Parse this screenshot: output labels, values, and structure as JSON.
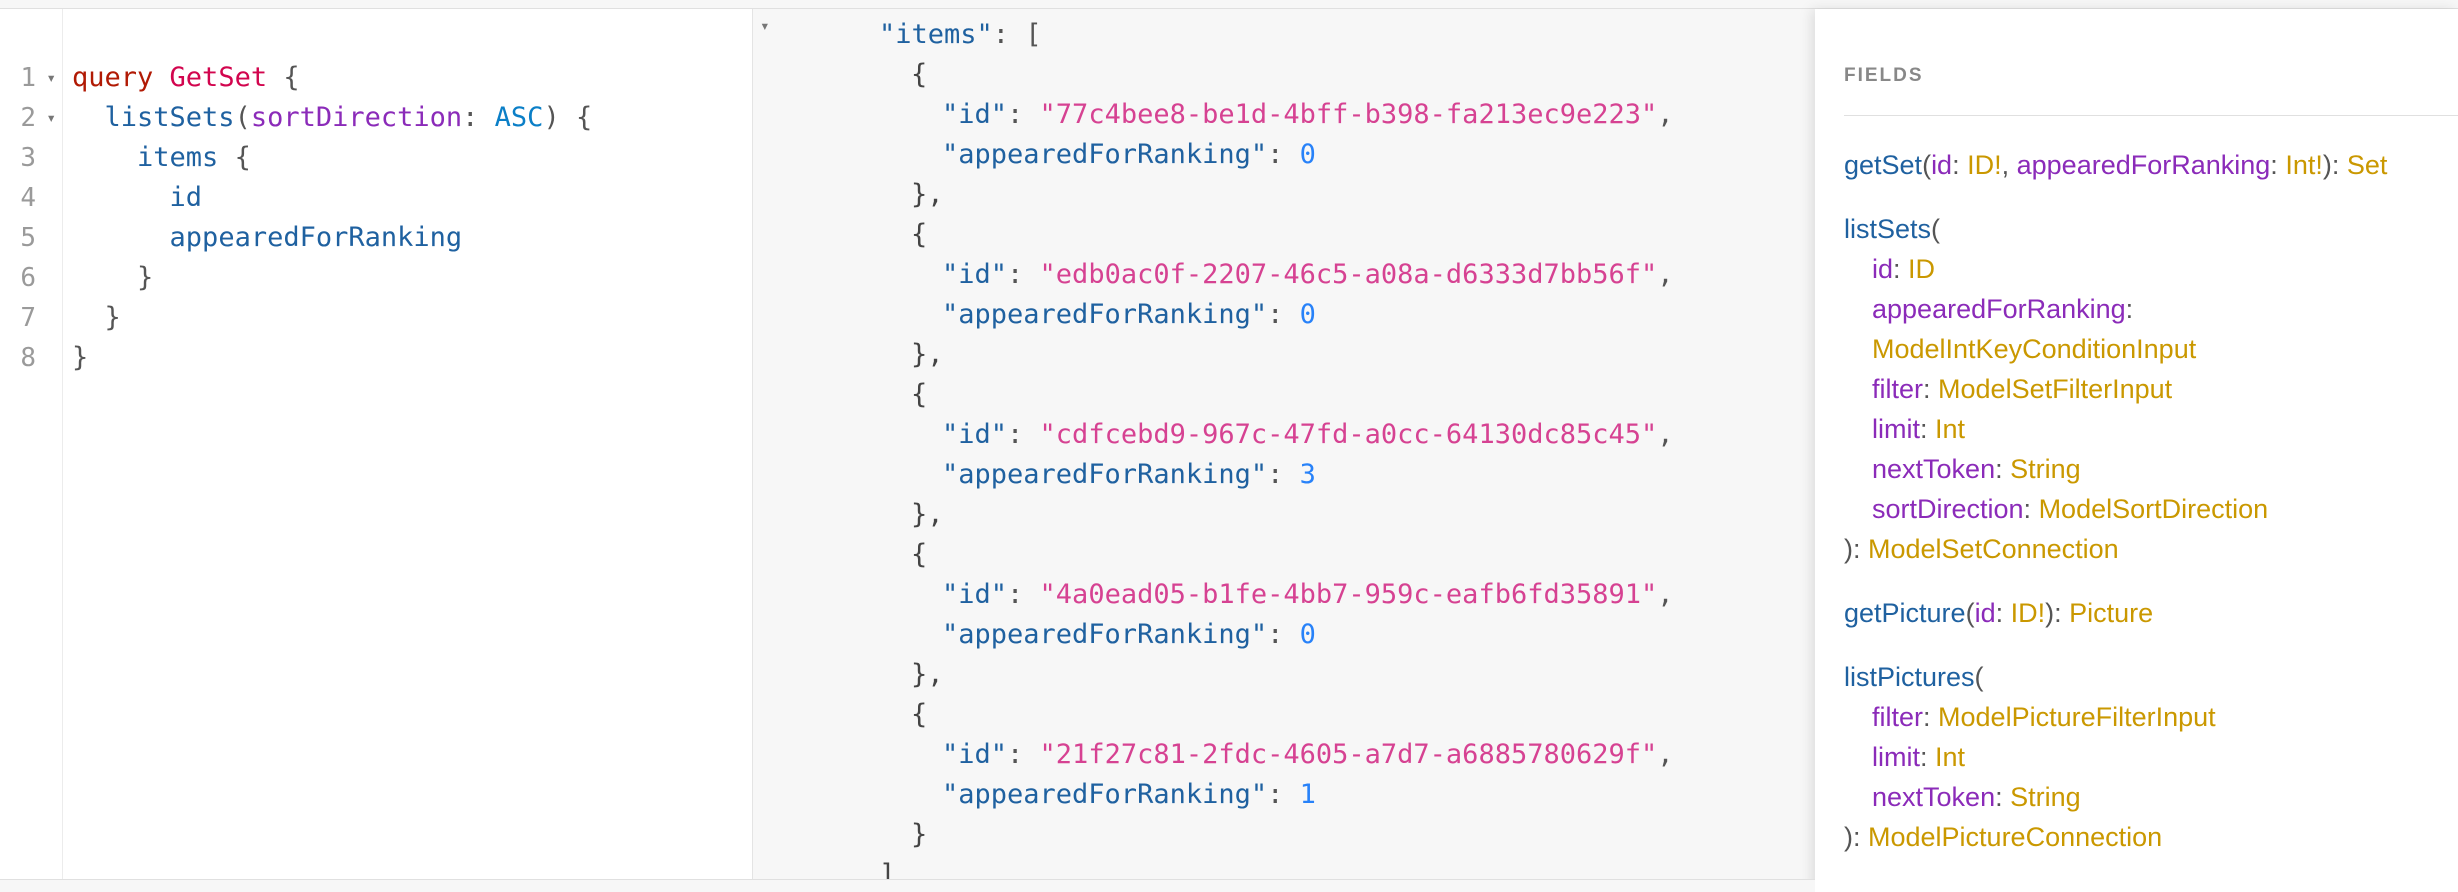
{
  "query_editor": {
    "gutter": [
      {
        "num": "1",
        "fold": "▾"
      },
      {
        "num": "2",
        "fold": "▾"
      },
      {
        "num": "3",
        "fold": ""
      },
      {
        "num": "4",
        "fold": ""
      },
      {
        "num": "5",
        "fold": ""
      },
      {
        "num": "6",
        "fold": ""
      },
      {
        "num": "7",
        "fold": ""
      },
      {
        "num": "8",
        "fold": ""
      }
    ],
    "keyword_query": "query",
    "operation_name": "GetSet",
    "open_brace": "{",
    "close_brace": "}",
    "list_sets_field": "listSets",
    "sort_arg": "sortDirection",
    "sort_value": "ASC",
    "items_field": "items",
    "id_field": "id",
    "appeared_field": "appearedForRanking"
  },
  "result_viewer": {
    "fold_marker": "▾",
    "items_key": "\"items\"",
    "open_bracket": "[",
    "close_bracket": "]",
    "id_key": "\"id\"",
    "appeared_key": "\"appearedForRanking\"",
    "records": [
      {
        "id": "\"77c4bee8-be1d-4bff-b398-fa213ec9e223\"",
        "appeared": "0"
      },
      {
        "id": "\"edb0ac0f-2207-46c5-a08a-d6333d7bb56f\"",
        "appeared": "0"
      },
      {
        "id": "\"cdfcebd9-967c-47fd-a0cc-64130dc85c45\"",
        "appeared": "3"
      },
      {
        "id": "\"4a0ead05-b1fe-4bb7-959c-eafb6fd35891\"",
        "appeared": "0"
      },
      {
        "id": "\"21f27c81-2fdc-4605-a7d7-a6885780629f\"",
        "appeared": "1"
      }
    ]
  },
  "docs": {
    "title": "FIELDS",
    "get_set": {
      "name": "getSet",
      "arg_id": "id",
      "type_id": "ID!",
      "arg_appeared": "appearedForRanking",
      "type_int_req": "Int!",
      "return_type": "Set"
    },
    "list_sets": {
      "name": "listSets",
      "args": [
        {
          "name": "id",
          "type": "ID"
        },
        {
          "name": "appearedForRanking",
          "type": "ModelIntKeyConditionInput"
        },
        {
          "name": "filter",
          "type": "ModelSetFilterInput"
        },
        {
          "name": "limit",
          "type": "Int"
        },
        {
          "name": "nextToken",
          "type": "String"
        },
        {
          "name": "sortDirection",
          "type": "ModelSortDirection"
        }
      ],
      "return_type": "ModelSetConnection"
    },
    "get_picture": {
      "name": "getPicture",
      "arg_id": "id",
      "type_id": "ID!",
      "return_type": "Picture"
    },
    "list_pictures": {
      "name": "listPictures",
      "args": [
        {
          "name": "filter",
          "type": "ModelPictureFilterInput"
        },
        {
          "name": "limit",
          "type": "Int"
        },
        {
          "name": "nextToken",
          "type": "String"
        }
      ],
      "return_type": "ModelPictureConnection"
    }
  }
}
